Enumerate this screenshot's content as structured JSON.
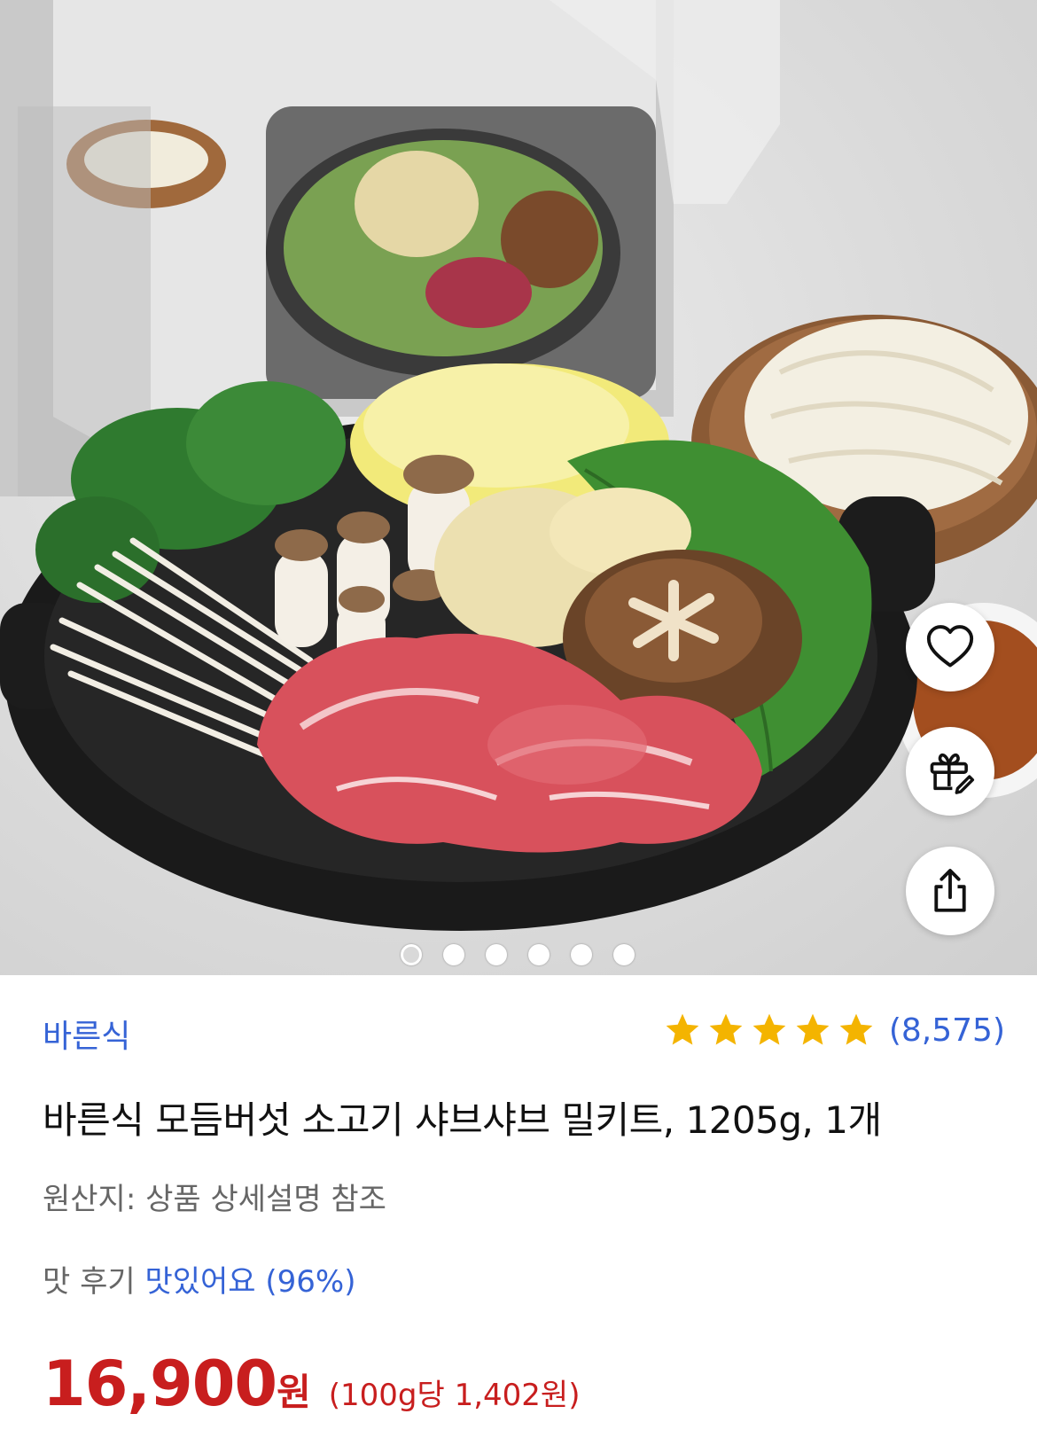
{
  "gallery": {
    "image_alt": "바른식 모듬버섯 소고기 샤브샤브 밀키트",
    "dot_count": 6,
    "active_index": 0
  },
  "actions": {
    "like_icon": "heart-icon",
    "gift_icon": "gift-icon",
    "share_icon": "share-icon"
  },
  "product": {
    "brand": "바른식",
    "rating_stars": 5,
    "rating_count": "(8,575)",
    "title": "바른식 모듬버섯 소고기 샤브샤브 밀키트, 1205g, 1개",
    "origin": "원산지: 상품 상세설명 참조",
    "review_label": "맛 후기",
    "review_value": "맛있어요 (96%)",
    "price": "16,900",
    "price_unit": "원",
    "unit_price": "(100g당 1,402원)"
  },
  "colors": {
    "accent_blue": "#3563d6",
    "price_red": "#c81e1e",
    "star_gold": "#f4b400"
  }
}
